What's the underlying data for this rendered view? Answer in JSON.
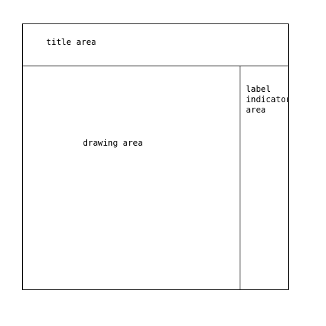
{
  "regions": {
    "title": "title area",
    "drawing": "drawing area",
    "label_lines": [
      "label",
      "indicator",
      "area"
    ]
  }
}
